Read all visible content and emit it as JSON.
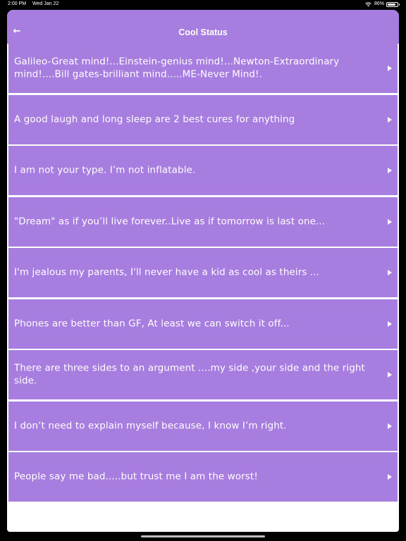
{
  "status_bar": {
    "time": "2:00 PM",
    "date": "Wed Jan 22",
    "battery": "86%",
    "battery_level": 0.86
  },
  "nav": {
    "back_icon": "arrow-left-icon",
    "back_glyph": "←",
    "title": "Cool Status"
  },
  "list": {
    "items": [
      "Galileo-Great mind!...Einstein-genius mind!...Newton-Extraordinary mind!....Bill gates-brilliant mind.....ME-Never Mind!.",
      "A good laugh and long sleep are 2 best cures for anything",
      "I am not your type. I’m not inflatable.",
      "\"Dream\" as if you’ll live forever..Live as if tomorrow is last one...",
      "I'm jealous my parents, I'll never have a kid as cool as theirs ...",
      "Phones are better than GF, At least we can switch it off...",
      "There are three sides to an argument ....my side ,your side and the right side.",
      "I don’t need to explain myself because, I know I’m right.",
      "People say me bad.....but trust me I am the worst!"
    ]
  },
  "colors": {
    "accent": "#a87de0",
    "background": "#ffffff",
    "text": "#ffffff"
  }
}
